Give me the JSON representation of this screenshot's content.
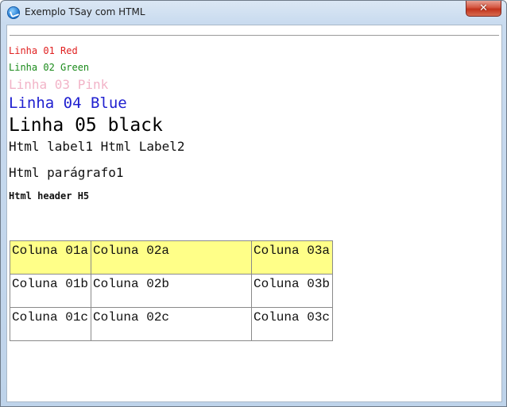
{
  "window": {
    "title": "Exemplo TSay com HTML",
    "close_label": "✕"
  },
  "lines": [
    {
      "text": "Linha 01 Red",
      "color": "#e02020"
    },
    {
      "text": "Linha 02 Green",
      "color": "#1a8a1a"
    },
    {
      "text": "Linha 03 Pink",
      "color": "#f2b4c8"
    },
    {
      "text": "Linha 04 Blue",
      "color": "#2020d0"
    },
    {
      "text": "Linha 05 black",
      "color": "#000000"
    }
  ],
  "labels_text": "Html label1 Html Label2",
  "paragraph_text": "Html parágrafo1",
  "header_h5": "Html header H5",
  "table": {
    "rows": [
      [
        "Coluna 01a",
        "Coluna 02a",
        "Coluna 03a"
      ],
      [
        "Coluna 01b",
        "Coluna 02b",
        "Coluna 03b"
      ],
      [
        "Coluna 01c",
        "Coluna 02c",
        "Coluna 03c"
      ]
    ],
    "header_bg": "#ffff88"
  }
}
